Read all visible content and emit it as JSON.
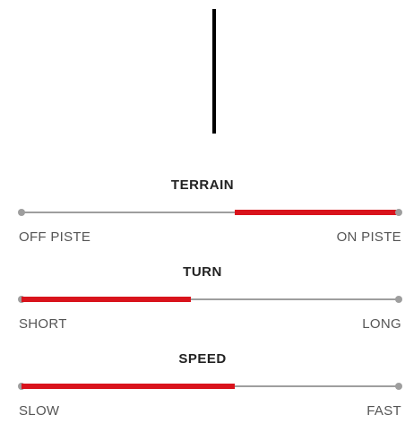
{
  "sliders": [
    {
      "title": "TERRAIN",
      "left_label": "OFF PISTE",
      "right_label": "ON PISTE",
      "fill_start": 0.565,
      "fill_end": 1.0
    },
    {
      "title": "TURN",
      "left_label": "SHORT",
      "right_label": "LONG",
      "fill_start": 0.0,
      "fill_end": 0.45
    },
    {
      "title": "SPEED",
      "left_label": "SLOW",
      "right_label": "FAST",
      "fill_start": 0.0,
      "fill_end": 0.565
    }
  ],
  "colors": {
    "accent": "#d9131c",
    "track": "#9e9e9e",
    "divider": "#000000"
  }
}
